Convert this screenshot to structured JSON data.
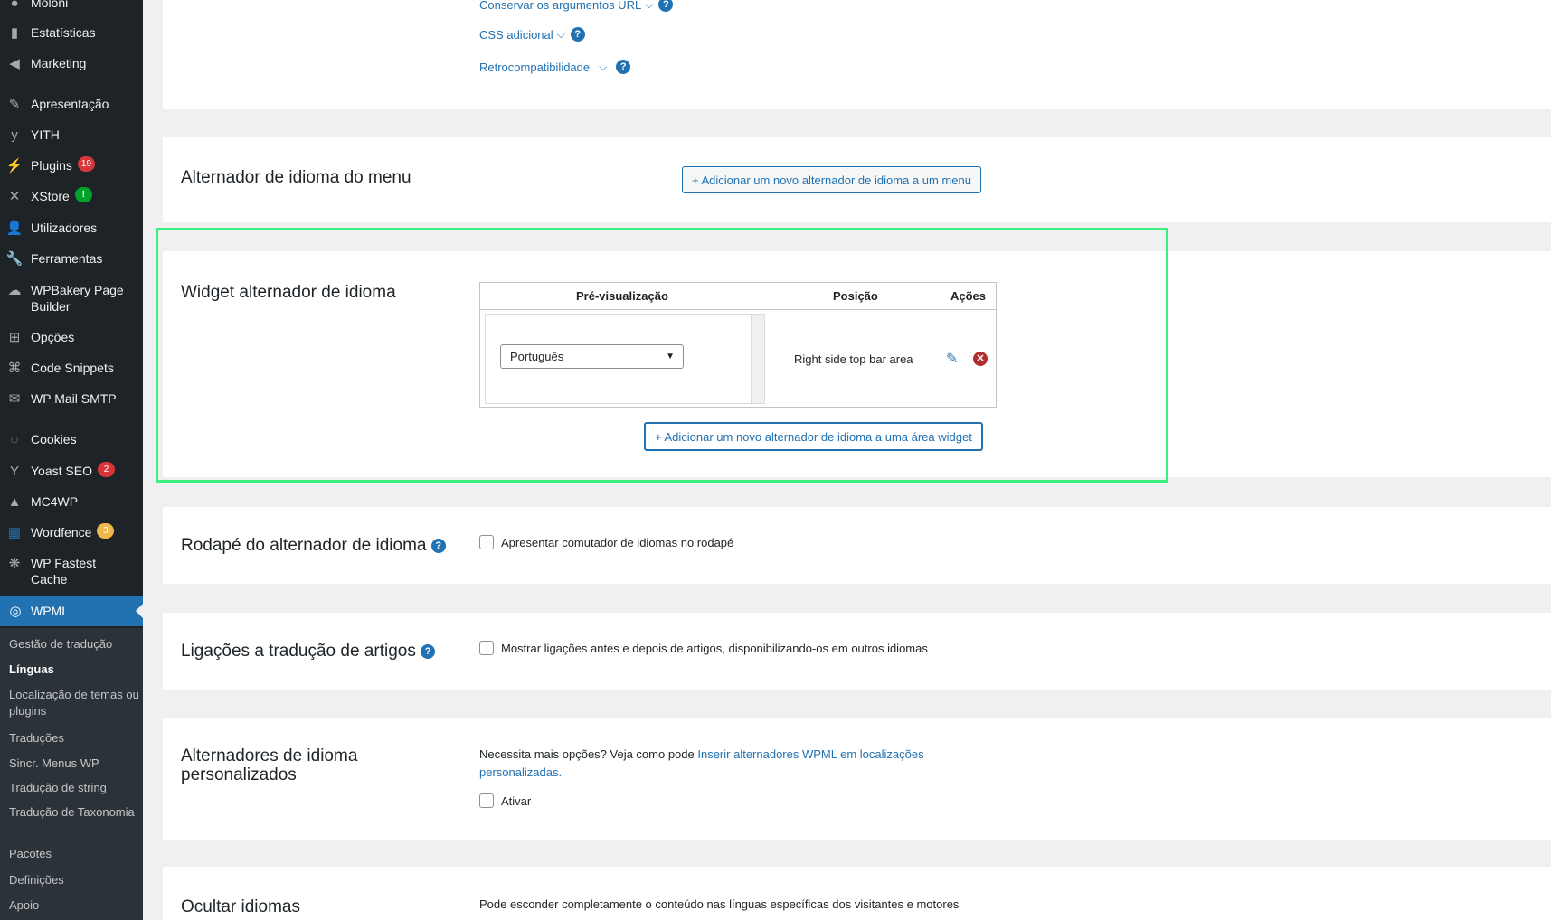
{
  "sidebar": {
    "items": [
      {
        "label": "Moloni",
        "icon": "moloni-icon"
      },
      {
        "label": "Estatísticas",
        "icon": "chart-icon"
      },
      {
        "label": "Marketing",
        "icon": "megaphone-icon"
      },
      {
        "label": "Apresentação",
        "icon": "brush-icon"
      },
      {
        "label": "YITH",
        "icon": "yith-icon"
      },
      {
        "label": "Plugins",
        "icon": "plugin-icon",
        "badge": "19"
      },
      {
        "label": "XStore",
        "icon": "xstore-icon",
        "badge": "!"
      },
      {
        "label": "Utilizadores",
        "icon": "user-icon"
      },
      {
        "label": "Ferramentas",
        "icon": "wrench-icon"
      },
      {
        "label": "WPBakery Page Builder",
        "icon": "wpbakery-icon"
      },
      {
        "label": "Opções",
        "icon": "settings-icon"
      },
      {
        "label": "Code Snippets",
        "icon": "code-icon"
      },
      {
        "label": "WP Mail SMTP",
        "icon": "mail-icon"
      },
      {
        "label": "Cookies",
        "icon": "cookie-icon"
      },
      {
        "label": "Yoast SEO",
        "icon": "yoast-icon",
        "badge": "2"
      },
      {
        "label": "MC4WP",
        "icon": "mc4wp-icon"
      },
      {
        "label": "Wordfence",
        "icon": "wordfence-icon",
        "badge": "3"
      },
      {
        "label": "WP Fastest Cache",
        "icon": "cheetah-icon"
      }
    ],
    "current": {
      "label": "WPML",
      "icon": "wpml-icon"
    },
    "submenu": [
      "Gestão de tradução",
      "Línguas",
      "Localização de temas ou plugins",
      "Traduções",
      "Sincr. Menus WP",
      "Tradução de string",
      "Tradução de Taxonomia",
      "Pacotes",
      "Definições",
      "Apoio"
    ],
    "colors": {
      "bg": "#1d2327",
      "current": "#2271b1",
      "submenu_bg": "#2c3338"
    }
  },
  "top": {
    "links": [
      "Conservar os argumentos URL",
      "CSS adicional",
      "Retrocompatibilidade"
    ]
  },
  "menu_switcher": {
    "title": "Alternador de idioma do menu",
    "button": "+ Adicionar um novo alternador de idioma a um menu"
  },
  "widget_switcher": {
    "title": "Widget alternador de idioma",
    "headers": {
      "preview": "Pré-visualização",
      "position": "Posição",
      "actions": "Ações"
    },
    "row": {
      "language": "Português",
      "position": "Right side top bar area"
    },
    "button": "+ Adicionar um novo alternador de idioma a uma área widget"
  },
  "footer_switcher": {
    "title": "Rodapé do alternador de idioma",
    "checkbox": "Apresentar comutador de idiomas no rodapé"
  },
  "post_links": {
    "title": "Ligações a tradução de artigos",
    "checkbox": "Mostrar ligações antes e depois de artigos, disponibilizando-os em outros idiomas"
  },
  "custom_switchers": {
    "title": "Alternadores de idioma personalizados",
    "text": "Necessita mais opções? Veja como pode ",
    "link": "Inserir alternadores WPML em localizações personalizadas.",
    "checkbox": "Ativar"
  },
  "hide_languages": {
    "title": "Ocultar idiomas",
    "text": "Pode esconder completamente o conteúdo nas línguas específicas dos visitantes e motores"
  },
  "colors": {
    "accent": "#2271b1",
    "highlight": "#3cf07f",
    "danger": "#d63638"
  }
}
